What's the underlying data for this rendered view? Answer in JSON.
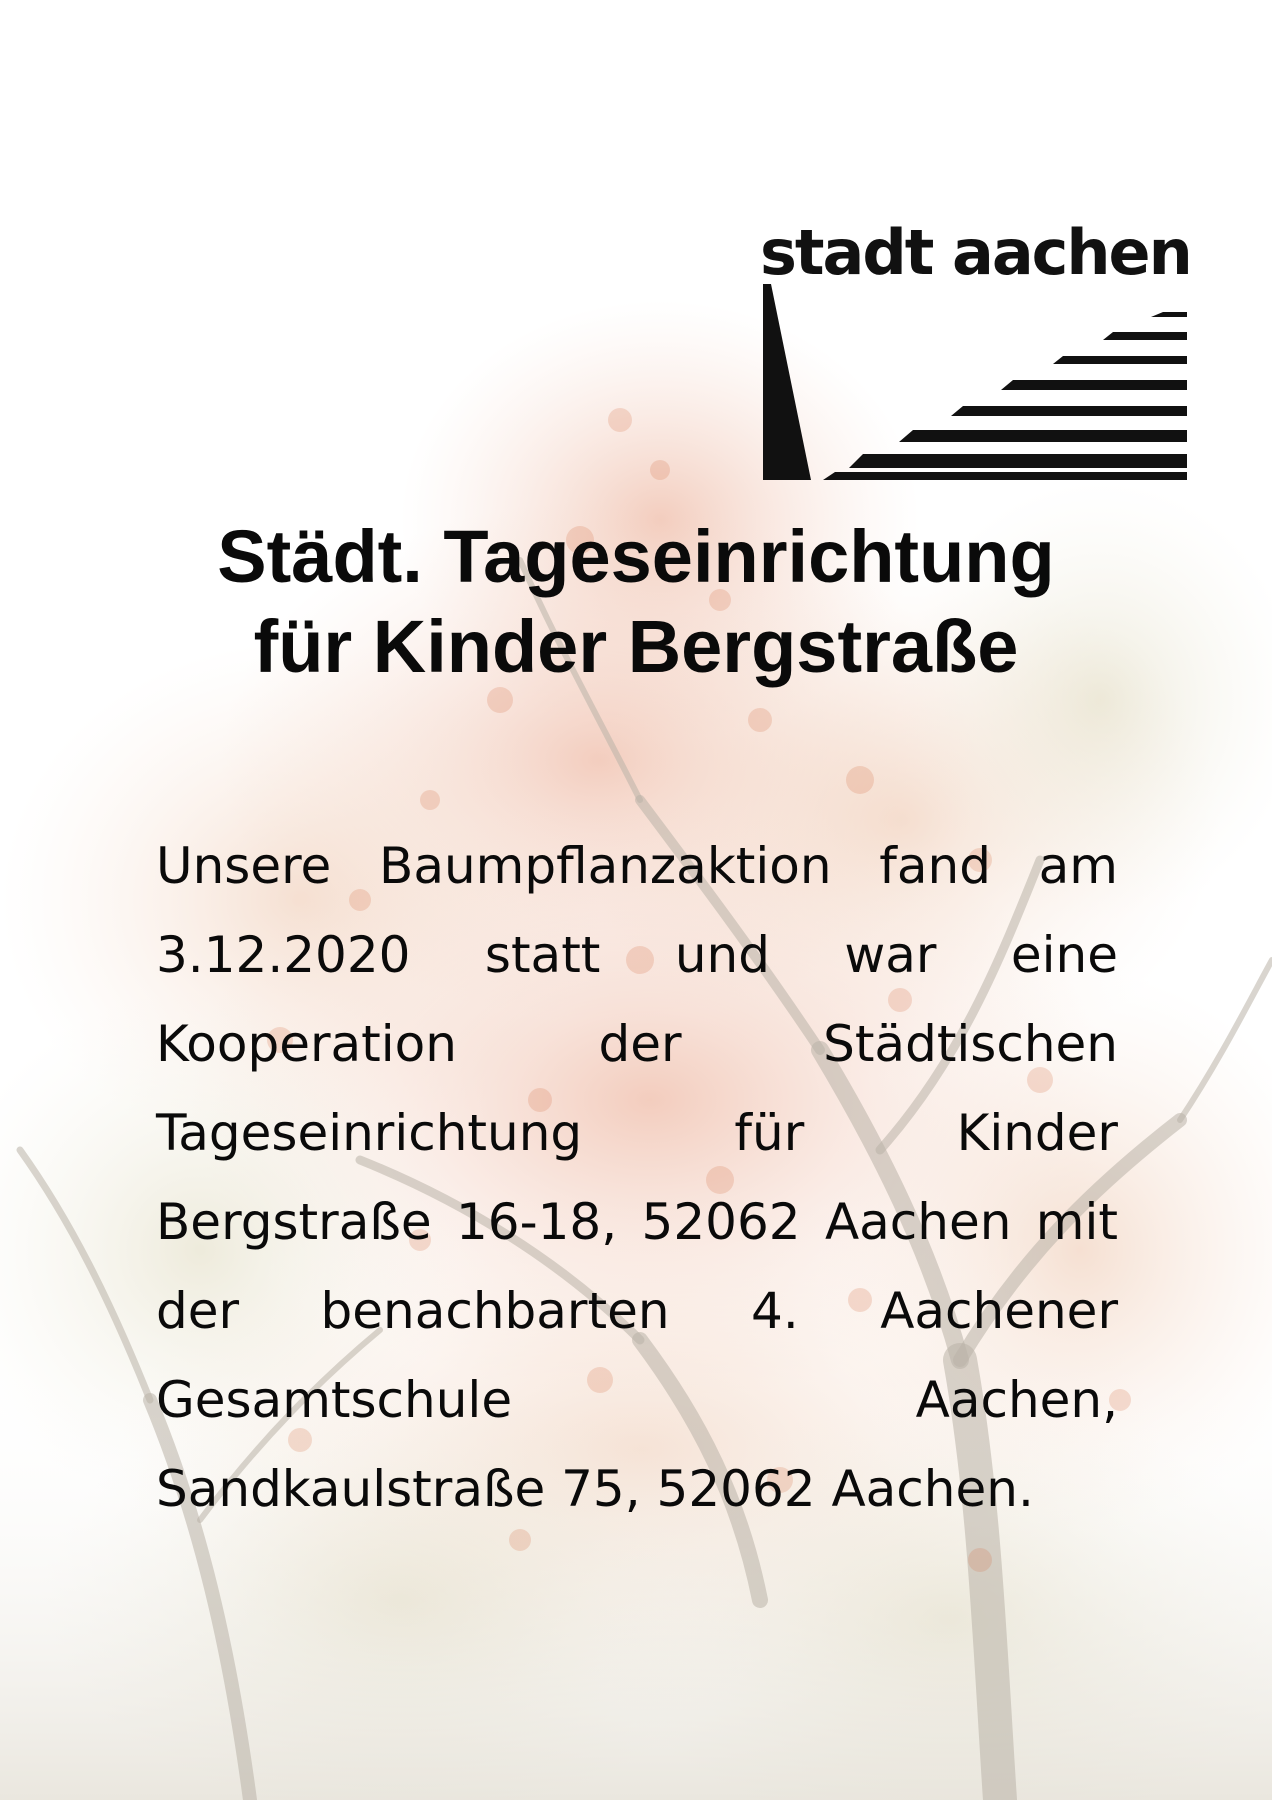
{
  "logo": {
    "text": "stadt aachen"
  },
  "title": {
    "line1": "Städt. Tageseinrichtung",
    "line2": "für Kinder Bergstraße"
  },
  "body": {
    "paragraph": "Unsere Baumpflanzaktion fand am 3.12.2020 statt und war eine Kooperation der Städtischen Tageseinrichtung für Kinder Bergstraße 16-18, 52062 Aachen mit der benachbarten 4. Aachener Gesamtschule Aachen, Sandkaulstraße 75, 52062 Aachen."
  },
  "colors": {
    "text": "#0a0a0a",
    "background": "#ffffff",
    "foliage": "#c8643a"
  }
}
